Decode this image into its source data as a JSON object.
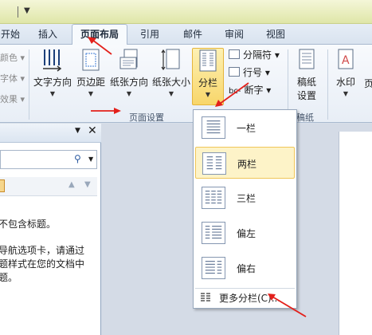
{
  "tabs": [
    {
      "label": "开始"
    },
    {
      "label": "插入"
    },
    {
      "label": "页面布局",
      "active": true
    },
    {
      "label": "引用"
    },
    {
      "label": "邮件"
    },
    {
      "label": "审阅"
    },
    {
      "label": "视图"
    }
  ],
  "ribbon": {
    "theme_items": [
      "颜色",
      "字体",
      "效果"
    ],
    "text_direction": "文字方向",
    "margins": "页边距",
    "orientation": "纸张方向",
    "size": "纸张大小",
    "columns": "分栏",
    "breaks": "分隔符",
    "line_numbers": "行号",
    "hyphenation": "断字",
    "page_setup_group": "页面设置",
    "draft_paper_line1": "稿纸",
    "draft_paper_line2": "设置",
    "draft_group": "稿纸",
    "watermark": "水印"
  },
  "nav_pane": {
    "line1": "不包含标题。",
    "line2": "导航选项卡，请通过",
    "line3": "题样式在您的文档中",
    "line4": "题。"
  },
  "columns_menu": {
    "items": [
      {
        "label": "一栏"
      },
      {
        "label": "两栏",
        "selected": true
      },
      {
        "label": "三栏"
      },
      {
        "label": "偏左"
      },
      {
        "label": "偏右"
      }
    ],
    "more": "更多分栏(C)..."
  },
  "colors": {
    "arrow": "#e3201b",
    "highlight": "#f8d66a"
  }
}
